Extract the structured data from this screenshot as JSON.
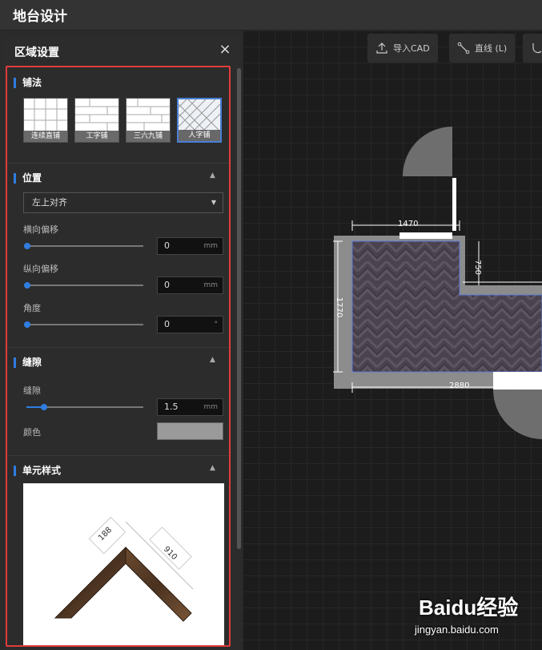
{
  "app": {
    "title": "地台设计"
  },
  "toolbar": {
    "import_cad": "导入CAD",
    "line": "直线 (L)"
  },
  "panel": {
    "title": "区域设置",
    "close_icon": "×",
    "pave": {
      "title": "铺法",
      "patterns": [
        {
          "label": "连续直铺",
          "selected": false
        },
        {
          "label": "工字铺",
          "selected": false
        },
        {
          "label": "三六九铺",
          "selected": false
        },
        {
          "label": "人字铺",
          "selected": true
        }
      ]
    },
    "position": {
      "title": "位置",
      "align_value": "左上对齐",
      "h_offset_label": "横向偏移",
      "h_offset_value": "0",
      "v_offset_label": "纵向偏移",
      "v_offset_value": "0",
      "angle_label": "角度",
      "angle_value": "0",
      "unit_mm": "mm",
      "unit_deg": "°"
    },
    "gap": {
      "title": "缝隙",
      "gap_label": "缝隙",
      "gap_value": "1.5",
      "gap_fraction": 0.15,
      "color_label": "颜色",
      "color_value": "#9a9a9a"
    },
    "unit_style": {
      "title": "单元样式",
      "dim_width": "188",
      "dim_length": "910"
    }
  },
  "floorplan": {
    "dims": {
      "top": "1470",
      "left": "1770",
      "bottom": "2880",
      "right_notch": "750"
    }
  },
  "watermark": {
    "brand": "Baidu经验",
    "url": "jingyan.baidu.com"
  },
  "colors": {
    "accent": "#2f7de1",
    "highlight": "#e03b3b",
    "floor": "#4e4452"
  }
}
